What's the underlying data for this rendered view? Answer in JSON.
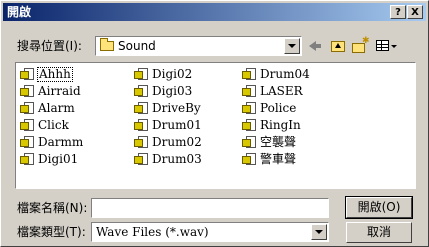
{
  "window": {
    "title": "開啟",
    "help_label": "?",
    "close_label": "X"
  },
  "lookin": {
    "label": "搜尋位置(I):",
    "value": "Sound"
  },
  "files": [
    {
      "name": "Ahhh",
      "selected": true
    },
    {
      "name": "Airraid"
    },
    {
      "name": "Alarm"
    },
    {
      "name": "Click"
    },
    {
      "name": "Darmm"
    },
    {
      "name": "Digi01"
    },
    {
      "name": "Digi02"
    },
    {
      "name": "Digi03"
    },
    {
      "name": "DriveBy"
    },
    {
      "name": "Drum01"
    },
    {
      "name": "Drum02"
    },
    {
      "name": "Drum03"
    },
    {
      "name": "Drum04"
    },
    {
      "name": "LASER"
    },
    {
      "name": "Police"
    },
    {
      "name": "RingIn"
    },
    {
      "name": "空襲聲"
    },
    {
      "name": "警車聲"
    }
  ],
  "filename": {
    "label": "檔案名稱(N):",
    "value": ""
  },
  "filetype": {
    "label": "檔案類型(T):",
    "value": "Wave Files (*.wav)"
  },
  "buttons": {
    "open": "開啟(O)",
    "cancel": "取消"
  },
  "icons": {
    "folder": "folder-icon",
    "back": "back-arrow-icon",
    "up": "up-folder-icon",
    "new_folder": "new-folder-icon",
    "view_menu": "view-menu-icon",
    "wav_file": "wav-file-icon"
  },
  "colors": {
    "title_start": "#0a246a",
    "title_end": "#a6caf0",
    "face": "#d4d0c8"
  }
}
